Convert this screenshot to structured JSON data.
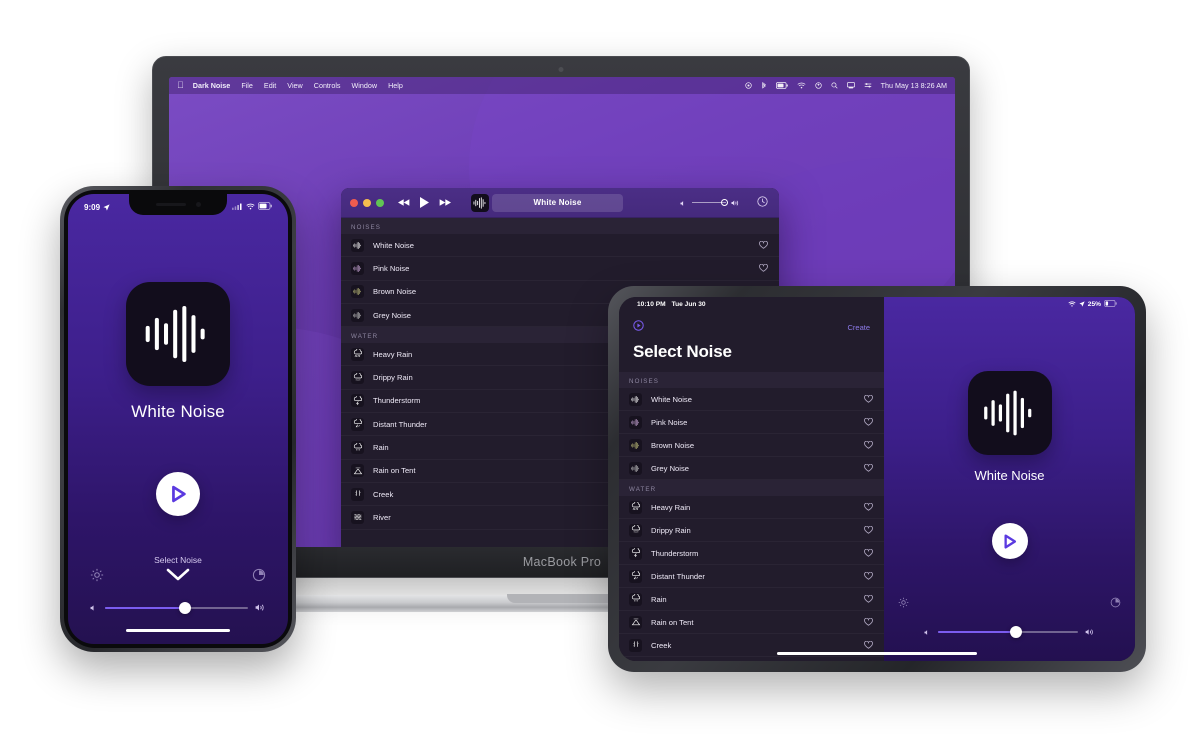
{
  "scene": {
    "devices": [
      "macbook-pro",
      "iphone",
      "ipad"
    ],
    "app_name": "Dark Noise"
  },
  "colors": {
    "accent_purple": "#6a3bb3",
    "app_dark": "#221c2c",
    "toolbar_purple": "#4b2e86",
    "play_triangle": "#5b3ae0",
    "slider_fill": "#7b5cf0",
    "create_link": "#8d7ae8"
  },
  "macbook": {
    "chin_label": "MacBook Pro",
    "menubar": {
      "apple_icon": "apple-logo-icon",
      "items": [
        {
          "label": "Dark Noise",
          "bold": true
        },
        {
          "label": "File",
          "bold": false
        },
        {
          "label": "Edit",
          "bold": false
        },
        {
          "label": "View",
          "bold": false
        },
        {
          "label": "Controls",
          "bold": false
        },
        {
          "label": "Window",
          "bold": false
        },
        {
          "label": "Help",
          "bold": false
        }
      ],
      "status_icons": [
        "record-icon",
        "bluetooth-icon",
        "battery-icon",
        "wifi-icon",
        "update-icon",
        "spotlight-search-icon",
        "screen-mirroring-icon",
        "control-center-icon"
      ],
      "clock": "Thu May 13  8:26 AM"
    },
    "window": {
      "traffic_lights": [
        "close",
        "minimize",
        "zoom"
      ],
      "transport": [
        "rewind-icon",
        "play-icon",
        "fast-forward-icon"
      ],
      "app_icon": "waveform-icon",
      "title": "White Noise",
      "volume": {
        "low_icon": "volume-low-icon",
        "high_icon": "volume-high-icon",
        "value": 100
      },
      "timer_icon": "timer-icon",
      "sections": [
        {
          "title": "NOISES",
          "items": [
            {
              "label": "White Noise",
              "icon": "waveform-icon",
              "favorite": false
            },
            {
              "label": "Pink Noise",
              "icon": "waveform-icon",
              "favorite": false
            },
            {
              "label": "Brown Noise",
              "icon": "waveform-icon",
              "favorite": false
            },
            {
              "label": "Grey Noise",
              "icon": "waveform-icon",
              "favorite": false
            }
          ]
        },
        {
          "title": "WATER",
          "items": [
            {
              "label": "Heavy Rain",
              "icon": "heavy-rain-icon",
              "favorite": false
            },
            {
              "label": "Drippy Rain",
              "icon": "drippy-rain-icon",
              "favorite": false
            },
            {
              "label": "Thunderstorm",
              "icon": "thunderstorm-icon",
              "favorite": false
            },
            {
              "label": "Distant Thunder",
              "icon": "distant-thunder-icon",
              "favorite": false
            },
            {
              "label": "Rain",
              "icon": "rain-icon",
              "favorite": false
            },
            {
              "label": "Rain on Tent",
              "icon": "rain-on-tent-icon",
              "favorite": false
            },
            {
              "label": "Creek",
              "icon": "creek-icon",
              "favorite": false
            },
            {
              "label": "River",
              "icon": "river-icon",
              "favorite": false
            }
          ]
        }
      ]
    }
  },
  "iphone": {
    "status": {
      "time": "9:09",
      "location_icon": "location-arrow-icon",
      "icons": [
        "cellular-icon",
        "wifi-icon",
        "battery-icon"
      ]
    },
    "now_playing": {
      "icon": "waveform-icon",
      "title": "White Noise",
      "play_icon": "play-icon"
    },
    "controls": {
      "select_label": "Select Noise",
      "chevron_icon": "chevron-down-icon",
      "settings_icon": "gear-icon",
      "timer_icon": "timer-icon",
      "volume_low_icon": "volume-low-icon",
      "volume_high_icon": "volume-high-icon",
      "volume_value": 56
    }
  },
  "ipad": {
    "status": {
      "time": "10:10 PM",
      "date": "Tue Jun 30",
      "wifi_icon": "wifi-icon",
      "location_icon": "location-arrow-icon",
      "battery_percent": "25%",
      "battery_icon": "battery-icon"
    },
    "sidebar": {
      "now_playing_icon": "circle-play-icon",
      "create_label": "Create",
      "title": "Select Noise",
      "sections": [
        {
          "title": "NOISES",
          "items": [
            {
              "label": "White Noise",
              "icon": "waveform-icon",
              "favorite": false
            },
            {
              "label": "Pink Noise",
              "icon": "waveform-icon",
              "favorite": false
            },
            {
              "label": "Brown Noise",
              "icon": "waveform-icon",
              "favorite": false
            },
            {
              "label": "Grey Noise",
              "icon": "waveform-icon",
              "favorite": false
            }
          ]
        },
        {
          "title": "WATER",
          "items": [
            {
              "label": "Heavy Rain",
              "icon": "heavy-rain-icon",
              "favorite": false
            },
            {
              "label": "Drippy Rain",
              "icon": "drippy-rain-icon",
              "favorite": false
            },
            {
              "label": "Thunderstorm",
              "icon": "thunderstorm-icon",
              "favorite": false
            },
            {
              "label": "Distant Thunder",
              "icon": "distant-thunder-icon",
              "favorite": false
            },
            {
              "label": "Rain",
              "icon": "rain-icon",
              "favorite": false
            },
            {
              "label": "Rain on Tent",
              "icon": "rain-on-tent-icon",
              "favorite": false
            },
            {
              "label": "Creek",
              "icon": "creek-icon",
              "favorite": false
            }
          ]
        }
      ]
    },
    "detail": {
      "icon": "waveform-icon",
      "title": "White Noise",
      "play_icon": "play-icon",
      "settings_icon": "gear-icon",
      "timer_icon": "timer-icon",
      "volume_low_icon": "volume-low-icon",
      "volume_high_icon": "volume-high-icon",
      "volume_value": 56
    }
  }
}
